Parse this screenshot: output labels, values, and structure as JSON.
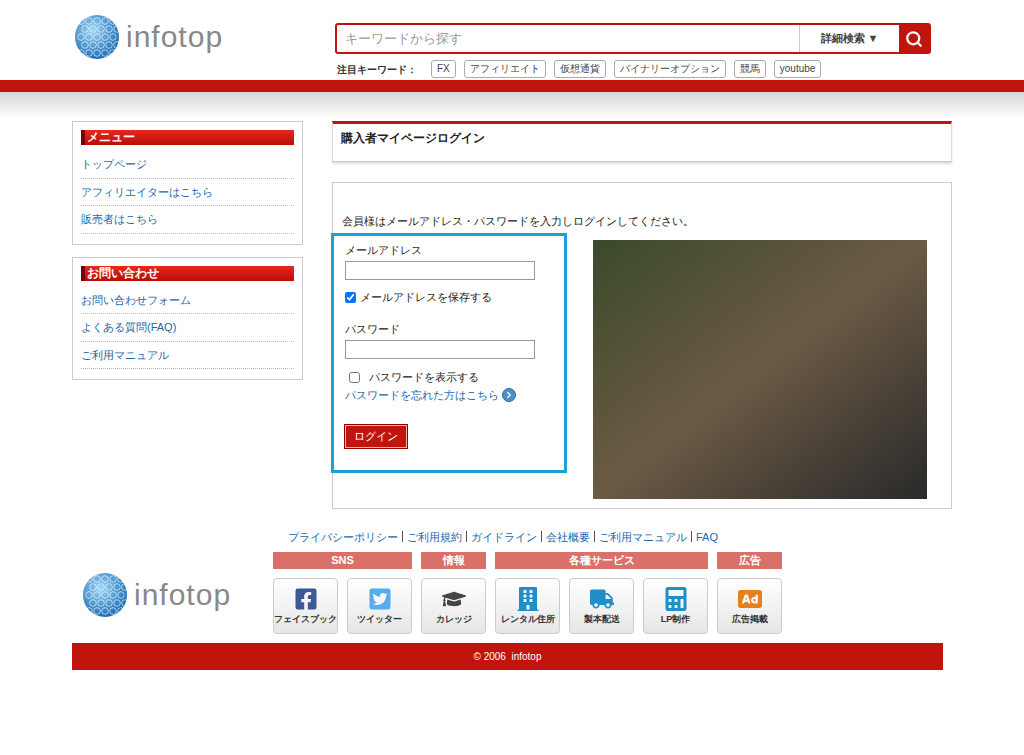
{
  "header": {
    "logo": "infotop",
    "search_placeholder": "キーワードから探す",
    "advanced_search": "詳細検索 ▼",
    "keywords_label": "注目キーワード：",
    "keywords": [
      "FX",
      "アフィリエイト",
      "仮想通貨",
      "バイナリーオプション",
      "競馬",
      "youtube"
    ]
  },
  "sidebar": [
    {
      "title": "メニュー",
      "items": [
        "トップページ",
        "アフィリエイターはこちら",
        "販売者はこちら"
      ]
    },
    {
      "title": "お問い合わせ",
      "items": [
        "お問い合わせフォーム",
        "よくある質問(FAQ)",
        "ご利用マニュアル"
      ]
    }
  ],
  "page_title": "購入者マイページログイン",
  "login": {
    "instruction": "会員様はメールアドレス・パスワードを入力しログインしてください。",
    "email_label": "メールアドレス",
    "remember": {
      "label": "メールアドレスを保存する",
      "checked": true
    },
    "password_label": "パスワード",
    "show_password": {
      "label": "パスワードを表示する",
      "checked": false
    },
    "forgot": "パスワードを忘れた方はこちら",
    "button": "ログイン"
  },
  "footer": {
    "links": [
      "プライバシーポリシー",
      "ご利用規約",
      "ガイドライン",
      "会社概要",
      "ご利用マニュアル",
      "FAQ"
    ],
    "logo": "infotop",
    "groups": [
      {
        "title": "SNS",
        "items": [
          "フェイスブック",
          "ツイッター"
        ]
      },
      {
        "title": "情報",
        "items": [
          "カレッジ"
        ]
      },
      {
        "title": "各種サービス",
        "items": [
          "レンタル住所",
          "製本配送",
          "LP制作"
        ]
      },
      {
        "title": "広告",
        "items": [
          "広告掲載"
        ]
      }
    ],
    "copyright": "© 2006  infotop"
  }
}
